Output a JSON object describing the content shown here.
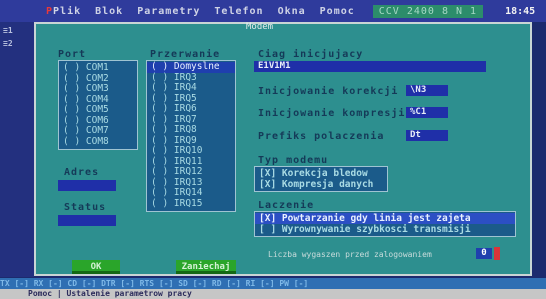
{
  "menubar": {
    "items": [
      "Plik",
      "Blok",
      "Parametry",
      "Telefon",
      "Okna",
      "Pomoc"
    ],
    "status": "CCV 2400 8 N 1",
    "clock": "18:45"
  },
  "dialog": {
    "title": "Modem",
    "ports_label": "Port",
    "ports": [
      "( ) COM1",
      "( ) COM2",
      "( ) COM3",
      "( ) COM4",
      "( ) COM5",
      "( ) COM6",
      "( ) COM7",
      "( ) COM8"
    ],
    "adres_label": "Adres",
    "status_label": "Status",
    "irq_label": "Przerwanie",
    "irqs": [
      "( ) Domyslne",
      "( ) IRQ3",
      "( ) IRQ4",
      "( ) IRQ5",
      "( ) IRQ6",
      "( ) IRQ7",
      "( ) IRQ8",
      "( ) IRQ9",
      "( ) IRQ10",
      "( ) IRQ11",
      "( ) IRQ12",
      "( ) IRQ13",
      "( ) IRQ14",
      "( ) IRQ15"
    ],
    "init_label": "Ciag inicjujacy",
    "init_value": "E1V1M1",
    "correction_label": "Inicjowanie korekcji",
    "correction_value": "\\N3",
    "compression_label": "Inicjowanie kompresji",
    "compression_value": "%C1",
    "prefix_label": "Prefiks polaczenia",
    "prefix_value": "Dt",
    "type_label": "Typ modemu",
    "types": [
      "[X] Korekcja bledow",
      "[X] Kompresja danych"
    ],
    "conn_label": "Laczenie",
    "conn_opts": [
      "[X] Powtarzanie gdy linia jest zajeta",
      "[ ] Wyrownywanie szybkosci transmisji"
    ],
    "hint": "Liczba wygaszen przed zalogowaniem",
    "hint_value": "0",
    "ok_label": "OK",
    "cancel_label": "Zaniechaj"
  },
  "fnbar": {
    "text": "  TX [-]   RX [-]   CD [-]   DTR [-]   RTS [-]   SD [-]   RD [-]   RI [-]   PW [-]"
  },
  "statusline": {
    "text": "Pomoc | Ustalenie parametrow pracy"
  },
  "colors": {
    "dialog_bg": "#2d8f8f",
    "desktop": "#1c2a6e",
    "field": "#1f2fa8",
    "button": "#2aa52a"
  }
}
